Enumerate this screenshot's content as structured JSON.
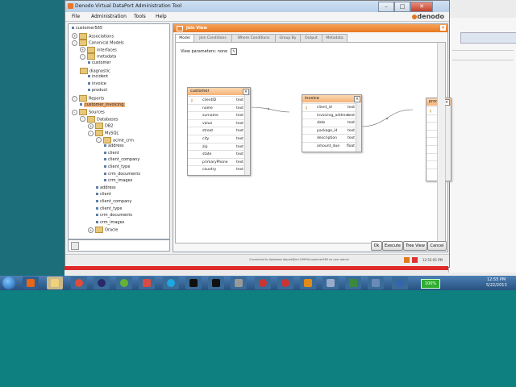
{
  "window": {
    "title": "Denodo Virtual DataPort Administration Tool"
  },
  "menu": [
    "File",
    "Administration",
    "Tools",
    "Help"
  ],
  "brand": "denodo",
  "tree": [
    {
      "label": "customer565",
      "indent": 0,
      "kind": "dot",
      "exp": ""
    },
    {
      "label": "Associations",
      "indent": 0,
      "kind": "fold",
      "exp": "+"
    },
    {
      "label": "Canonical Models",
      "indent": 0,
      "kind": "fold",
      "exp": "-"
    },
    {
      "label": "interfaces",
      "indent": 1,
      "kind": "fold",
      "exp": "+"
    },
    {
      "label": "metadata",
      "indent": 1,
      "kind": "fold",
      "exp": "-"
    },
    {
      "label": "customer",
      "indent": 2,
      "kind": "dot",
      "exp": ""
    },
    {
      "label": "diagnostic",
      "indent": 1,
      "kind": "fold",
      "exp": ""
    },
    {
      "label": "incident",
      "indent": 2,
      "kind": "dot",
      "exp": ""
    },
    {
      "label": "invoice",
      "indent": 2,
      "kind": "dot",
      "exp": ""
    },
    {
      "label": "product",
      "indent": 2,
      "kind": "dot",
      "exp": ""
    },
    {
      "label": "Reports",
      "indent": 0,
      "kind": "fold",
      "exp": "-"
    },
    {
      "label": "customer_invoicing",
      "indent": 1,
      "kind": "dot",
      "exp": "",
      "sel": true
    },
    {
      "label": "Sources",
      "indent": 0,
      "kind": "fold",
      "exp": "-"
    },
    {
      "label": "Databases",
      "indent": 1,
      "kind": "fold",
      "exp": "-"
    },
    {
      "label": "DB2",
      "indent": 2,
      "kind": "fold",
      "exp": "+"
    },
    {
      "label": "MySQL",
      "indent": 2,
      "kind": "fold",
      "exp": "-"
    },
    {
      "label": "acme_crm",
      "indent": 3,
      "kind": "fold",
      "exp": "-"
    },
    {
      "label": "address",
      "indent": 4,
      "kind": "dot",
      "exp": ""
    },
    {
      "label": "client",
      "indent": 4,
      "kind": "dot",
      "exp": ""
    },
    {
      "label": "client_company",
      "indent": 4,
      "kind": "dot",
      "exp": ""
    },
    {
      "label": "client_type",
      "indent": 4,
      "kind": "dot",
      "exp": ""
    },
    {
      "label": "crm_documents",
      "indent": 4,
      "kind": "dot",
      "exp": ""
    },
    {
      "label": "crm_images",
      "indent": 4,
      "kind": "dot",
      "exp": ""
    },
    {
      "label": "address",
      "indent": 3,
      "kind": "dot",
      "exp": ""
    },
    {
      "label": "client",
      "indent": 3,
      "kind": "dot",
      "exp": ""
    },
    {
      "label": "client_company",
      "indent": 3,
      "kind": "dot",
      "exp": ""
    },
    {
      "label": "client_type",
      "indent": 3,
      "kind": "dot",
      "exp": ""
    },
    {
      "label": "crm_documents",
      "indent": 3,
      "kind": "dot",
      "exp": ""
    },
    {
      "label": "crm_images",
      "indent": 3,
      "kind": "dot",
      "exp": ""
    },
    {
      "label": "Oracle",
      "indent": 2,
      "kind": "fold",
      "exp": "+"
    }
  ],
  "view": {
    "title": "Join View",
    "tabs": [
      "Model",
      "Join Conditions",
      "Where Conditions",
      "Group By",
      "Output",
      "Metadata"
    ],
    "params_label": "View parameters:",
    "params_value": "none"
  },
  "entities": {
    "customer": {
      "name": "customer",
      "fields": [
        {
          "name": "clientID",
          "type": "text",
          "key": true
        },
        {
          "name": "name",
          "type": "text"
        },
        {
          "name": "surname",
          "type": "text"
        },
        {
          "name": "value",
          "type": "text"
        },
        {
          "name": "street",
          "type": "text"
        },
        {
          "name": "city",
          "type": "text"
        },
        {
          "name": "zip",
          "type": "text"
        },
        {
          "name": "state",
          "type": "text"
        },
        {
          "name": "primaryPhone",
          "type": "text"
        },
        {
          "name": "country",
          "type": "text"
        }
      ]
    },
    "invoice": {
      "name": "invoice",
      "fields": [
        {
          "name": "client_id",
          "type": "text",
          "key": true
        },
        {
          "name": "invoicing_address",
          "type": "text"
        },
        {
          "name": "date",
          "type": "text"
        },
        {
          "name": "package_id",
          "type": "text"
        },
        {
          "name": "description",
          "type": "text"
        },
        {
          "name": "amount_due",
          "type": "float"
        }
      ]
    },
    "product": {
      "name": "product",
      "fields": [
        {
          "name": "pa",
          "type": "",
          "key": true
        },
        {
          "name": "pa",
          "type": ""
        },
        {
          "name": "pa",
          "type": ""
        },
        {
          "name": "pr",
          "type": ""
        },
        {
          "name": "m",
          "type": ""
        },
        {
          "name": "sp",
          "type": ""
        },
        {
          "name": "co",
          "type": ""
        },
        {
          "name": "va",
          "type": ""
        },
        {
          "name": "va",
          "type": ""
        }
      ]
    }
  },
  "buttons": {
    "ok": "Ok",
    "execute": "Execute",
    "tree_view": "Tree View",
    "cancel": "Cancel"
  },
  "status": {
    "text": "Connected to database dbport@mi:19999/customer565 as user admin",
    "time": "12:55:05 PM"
  },
  "taskbar": {
    "battery": "100%",
    "time": "12:55 PM",
    "date": "5/22/2013"
  }
}
